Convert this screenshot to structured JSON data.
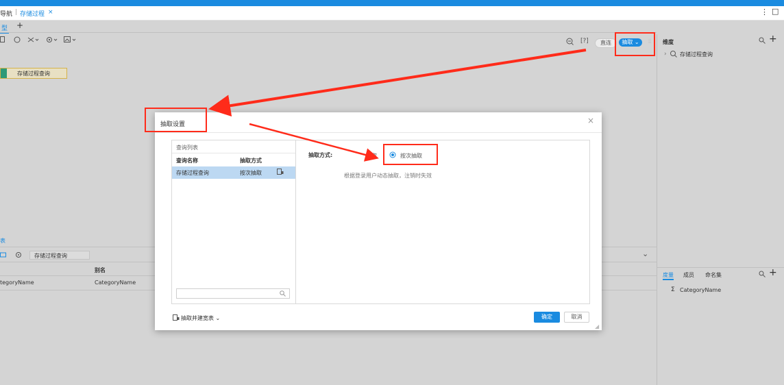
{
  "nav": {
    "prefix": "导航",
    "tab_label": "存储过程",
    "tab_close": "×"
  },
  "header": {
    "more_icon": "⋮",
    "maximize_icon": "□"
  },
  "subtabs": {
    "active": "型",
    "add": "+"
  },
  "toolbar": {
    "help_text": "[?]",
    "direct_label": "直连",
    "extract_label": "抽取"
  },
  "canvas": {
    "node_label": "存储过程查询"
  },
  "dim_panel": {
    "title": "维度",
    "item": "存储过程查询"
  },
  "measure_panel": {
    "tabs": [
      "度量",
      "成员",
      "命名集"
    ],
    "item": "CategoryName"
  },
  "bottom": {
    "title": "表",
    "query_name": "存储过程查询",
    "column_header": "别名",
    "row_col1": "tegoryName",
    "row_col2": "CategoryName"
  },
  "modal": {
    "title": "抽取设置",
    "close": "×",
    "list_title": "查询列表",
    "col_name": "查询名称",
    "col_mode": "抽取方式",
    "row_name": "存储过程查询",
    "row_mode": "按次抽取",
    "mode_label": "抽取方式:",
    "option1": "抽取",
    "option2": "按次抽取",
    "description": "根据登录用户动态抽取，注销时失效",
    "footer_link": "抽取并建宽表",
    "ok": "确定",
    "cancel": "取消"
  }
}
